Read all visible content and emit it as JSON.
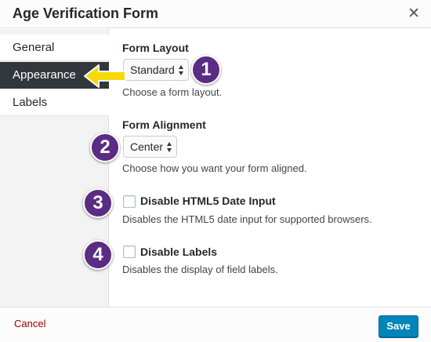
{
  "modal": {
    "title": "Age Verification Form",
    "close_symbol": "✕"
  },
  "sidebar": {
    "items": [
      {
        "label": "General",
        "active": false
      },
      {
        "label": "Appearance",
        "active": true
      },
      {
        "label": "Labels",
        "active": false
      }
    ]
  },
  "form": {
    "layout": {
      "label": "Form Layout",
      "selected": "Standard",
      "description": "Choose a form layout."
    },
    "alignment": {
      "label": "Form Alignment",
      "selected": "Center",
      "description": "Choose how you want your form aligned."
    },
    "html5_date": {
      "label": "Disable HTML5 Date Input",
      "checked": false,
      "description": "Disables the HTML5 date input for supported browsers."
    },
    "labels": {
      "label": "Disable Labels",
      "checked": false,
      "description": "Disables the display of field labels."
    }
  },
  "annotations": {
    "badges": [
      "1",
      "2",
      "3",
      "4"
    ],
    "badge_color": "#5b2c83",
    "arrow_color": "#f5d90a"
  },
  "footer": {
    "cancel_label": "Cancel",
    "save_label": "Save"
  },
  "colors": {
    "accent": "#0085ba",
    "sidebar_active": "#32373c",
    "cancel": "#a00000"
  }
}
